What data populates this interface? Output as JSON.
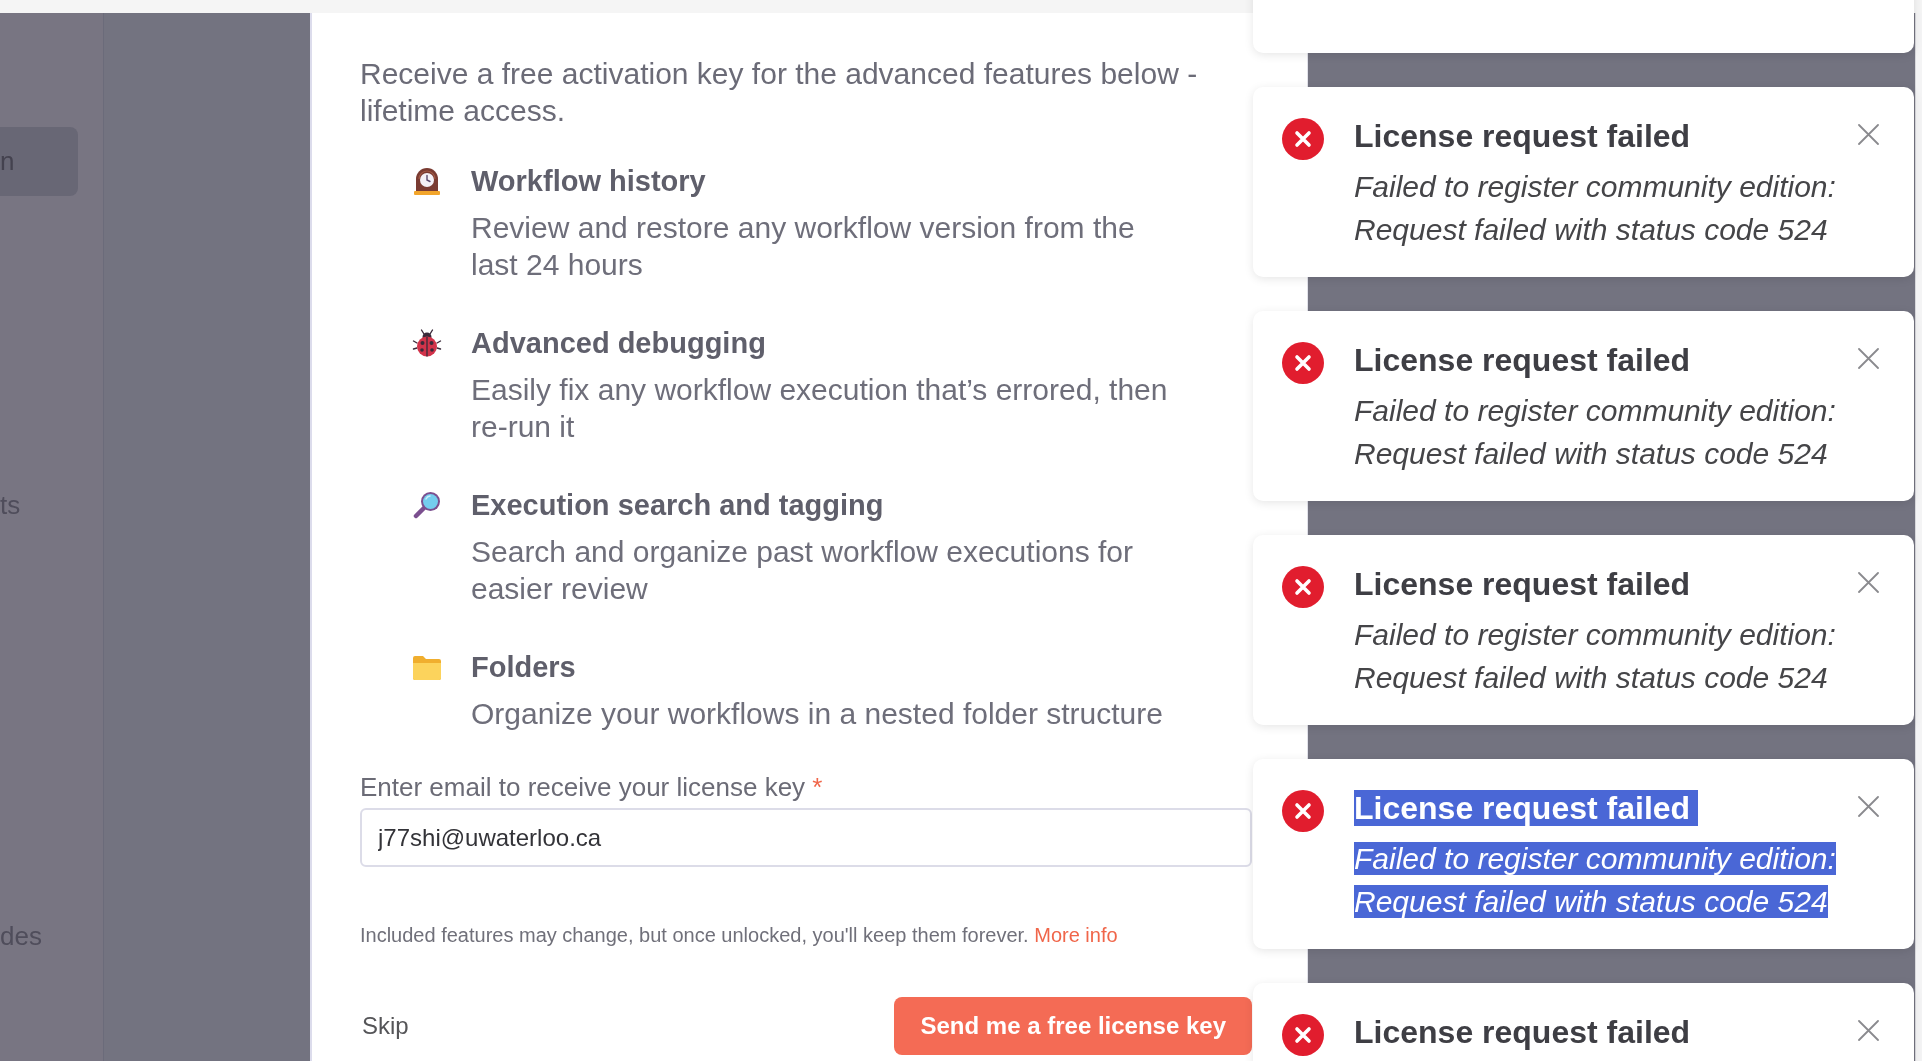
{
  "sidebar": {
    "items": [
      {
        "label": "n",
        "selected": true
      },
      {
        "label": "ts",
        "selected": false
      },
      {
        "label": "des",
        "selected": false
      }
    ]
  },
  "modal": {
    "intro": "Receive a free activation key for the advanced features below - lifetime access.",
    "features": [
      {
        "title": "Workflow history",
        "description": "Review and restore any workflow version from the last 24 hours"
      },
      {
        "title": "Advanced debugging",
        "description": "Easily fix any workflow execution that’s errored, then re-run it"
      },
      {
        "title": "Execution search and tagging",
        "description": "Search and organize past workflow executions for easier review"
      },
      {
        "title": "Folders",
        "description": "Organize your workflows in a nested folder structure"
      }
    ],
    "email_field": {
      "label": "Enter email to receive your license key",
      "required_mark": "*",
      "value": "j77shi@uwaterloo.ca"
    },
    "note": {
      "text": "Included features may change, but once unlocked, you'll keep them forever.",
      "link": "More info"
    },
    "skip_button": "Skip",
    "submit_button": "Send me a free license key"
  },
  "toasts": [
    {
      "title": "License request failed",
      "message": "Failed to register community edition: Request failed with status code 524",
      "highlighted": false
    },
    {
      "title": "License request failed",
      "message": "Failed to register community edition: Request failed with status code 524",
      "highlighted": false
    },
    {
      "title": "License request failed",
      "message": "Failed to register community edition: Request failed with status code 524",
      "highlighted": false
    },
    {
      "title": "License request failed",
      "message": "Failed to register community edition: Request failed with status code 524",
      "highlighted": true
    },
    {
      "title": "License request failed",
      "highlighted": false
    }
  ]
}
